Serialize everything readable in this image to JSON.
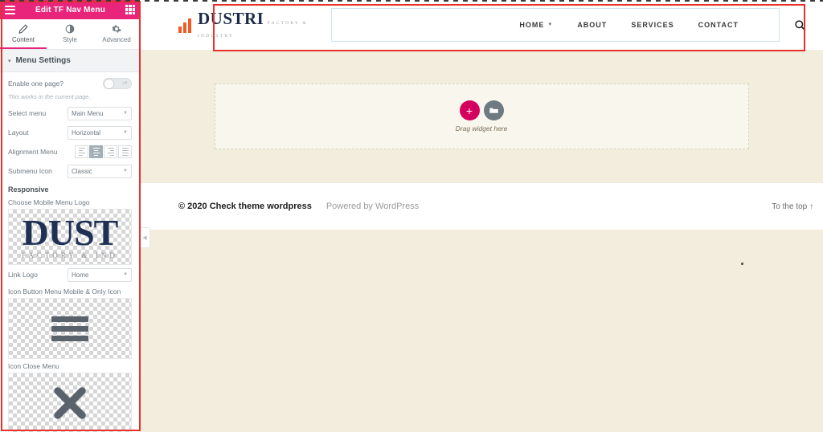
{
  "panel": {
    "header": {
      "title": "Edit TF Nav Menu",
      "menu_icon": "hamburger-icon",
      "grid_icon": "grid-icon"
    },
    "tabs": [
      {
        "label": "Content",
        "icon": "pencil-icon",
        "active": true
      },
      {
        "label": "Style",
        "icon": "contrast-icon",
        "active": false
      },
      {
        "label": "Advanced",
        "icon": "gear-icon",
        "active": false
      }
    ],
    "section": {
      "title": "Menu Settings",
      "caret": "▾"
    },
    "controls": {
      "enable_one_page": {
        "label": "Enable one page?",
        "value": "off",
        "hint": "This works in the current page."
      },
      "select_menu": {
        "label": "Select menu",
        "value": "Main Menu",
        "options": [
          "Main Menu"
        ]
      },
      "layout": {
        "label": "Layout",
        "value": "Horizontal",
        "options": [
          "Horizontal"
        ]
      },
      "alignment_menu": {
        "label": "Alignment Menu",
        "options": [
          "align-left",
          "align-center",
          "align-right",
          "align-justify"
        ],
        "selected_index": 1
      },
      "submenu_icon": {
        "label": "Submenu Icon",
        "value": "Classic",
        "options": [
          "Classic"
        ]
      }
    },
    "responsive": {
      "title": "Responsive",
      "mobile_logo_label": "Choose Mobile Menu Logo",
      "mobile_logo": {
        "primary_text": "DUST",
        "secondary_text": "FACTORY & IND"
      },
      "link_logo": {
        "label": "Link Logo",
        "value": "Home",
        "options": [
          "Home"
        ]
      },
      "icon_button_label": "Icon Button Menu Mobile & Only Icon",
      "icon_button": "hamburger-icon",
      "icon_close_label": "Icon Close Menu",
      "icon_close": "close-x-icon"
    }
  },
  "canvas": {
    "site_header": {
      "logo": {
        "name": "DUSTRI",
        "tagline": "FACTORY & INDUSTRY",
        "mark": "bar-chart-icon"
      },
      "nav_items": [
        {
          "label": "HOME",
          "has_dropdown": true
        },
        {
          "label": "ABOUT",
          "has_dropdown": false
        },
        {
          "label": "SERVICES",
          "has_dropdown": false
        },
        {
          "label": "CONTACT",
          "has_dropdown": false
        }
      ],
      "search_icon": "search-icon"
    },
    "dropzone": {
      "add_label": "+",
      "folder_icon": "folder-icon",
      "text": "Drag widget here"
    },
    "footer": {
      "copyright": "© 2020 Check theme wordpress",
      "powered_by": "Powered by WordPress",
      "to_top": "To the top ↑"
    },
    "collapse_handle": "◀"
  },
  "colors": {
    "panel_accent": "#e8257a",
    "annotation": "#e8312a",
    "brand_orange": "#f15a24",
    "brand_navy": "#1b2a47",
    "canvas_bg": "#f2eddd",
    "add_button": "#d4005e"
  }
}
